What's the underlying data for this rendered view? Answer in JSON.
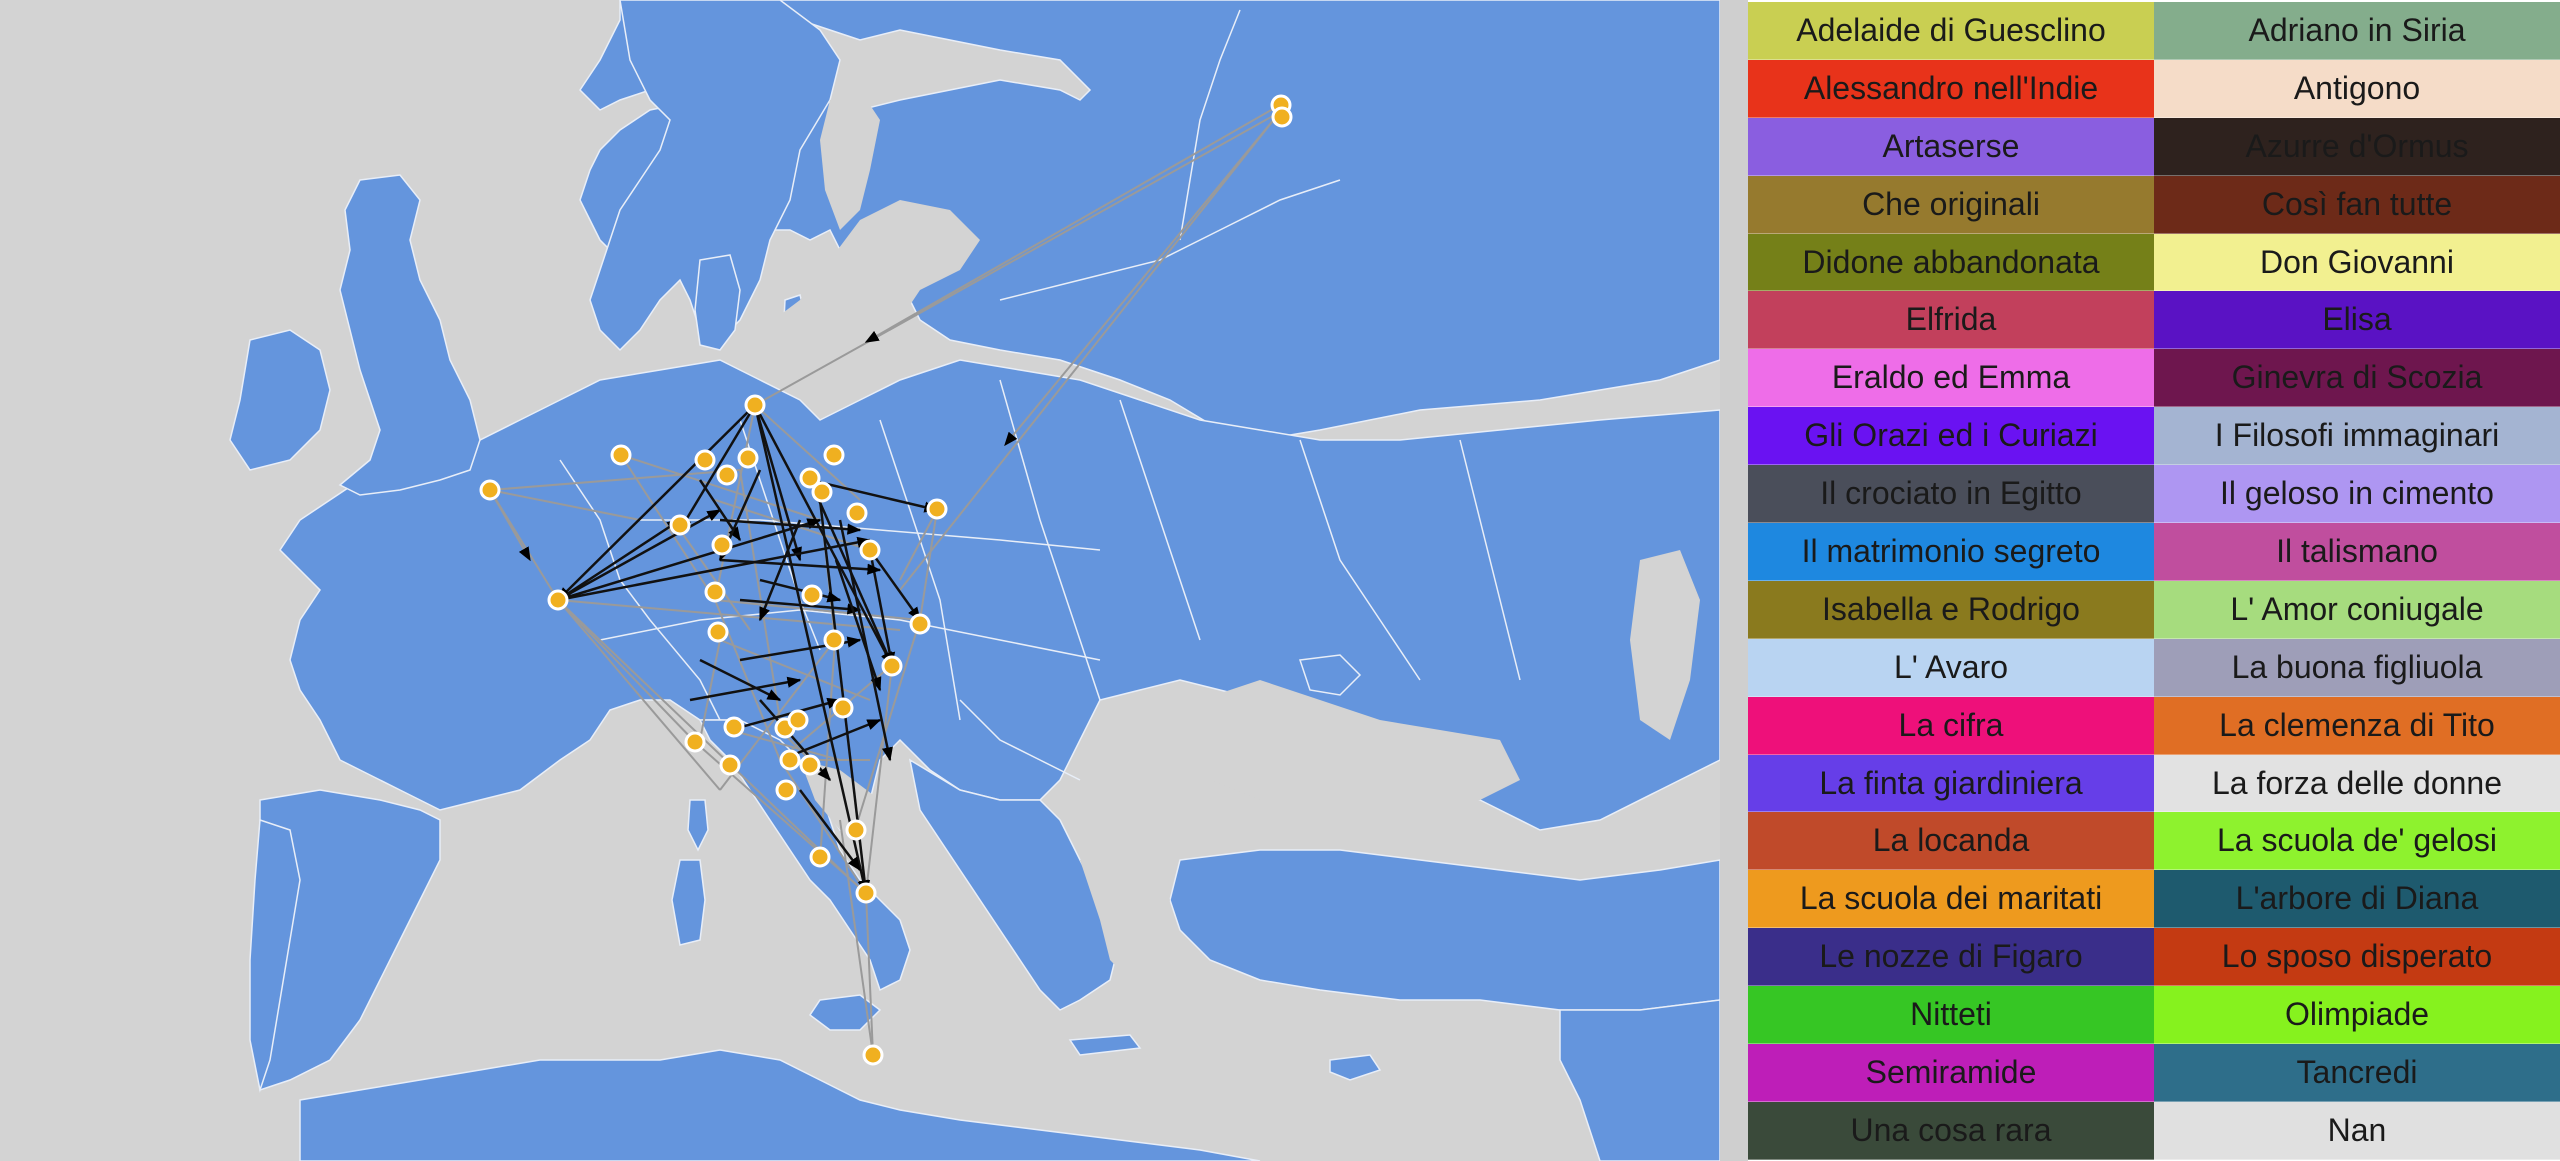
{
  "map": {
    "colors": {
      "sea": "#d3d3d3",
      "land": "#6495dd",
      "border": "#e8eef8",
      "node_fill": "#f0b020",
      "node_stroke": "#ffffff",
      "edge_light": "#9a9a9a",
      "edge_dark": "#000000"
    },
    "nodes_icon": "circle-marker",
    "edges_icon": "arrow-line"
  },
  "legend": {
    "items": [
      {
        "label": "Adelaide di Guesclino",
        "color": "#c9cf52"
      },
      {
        "label": "Adriano in Siria",
        "color": "#84ad8c"
      },
      {
        "label": "Alessandro nell'Indie",
        "color": "#e8331a"
      },
      {
        "label": "Antigono",
        "color": "#f5dcc8"
      },
      {
        "label": "Artaserse",
        "color": "#8a5ee0"
      },
      {
        "label": "Azurre d'Ormus",
        "color": "#2e221e"
      },
      {
        "label": "Che originali",
        "color": "#967a2e"
      },
      {
        "label": "Così fan tutte",
        "color": "#6d2a18"
      },
      {
        "label": "Didone abbandonata",
        "color": "#758018"
      },
      {
        "label": "Don Giovanni",
        "color": "#f2f090"
      },
      {
        "label": "Elfrida",
        "color": "#c2405c"
      },
      {
        "label": "Elisa",
        "color": "#5a12c4"
      },
      {
        "label": "Eraldo ed Emma",
        "color": "#ee6de8"
      },
      {
        "label": "Ginevra di Scozia",
        "color": "#6e164e"
      },
      {
        "label": "Gli Orazi ed i Curiazi",
        "color": "#6a12f2"
      },
      {
        "label": "I Filosofi immaginari",
        "color": "#a4b4d2"
      },
      {
        "label": "Il crociato in Egitto",
        "color": "#4a4e5a"
      },
      {
        "label": "Il geloso in cimento",
        "color": "#ae96f2"
      },
      {
        "label": "Il matrimonio segreto",
        "color": "#1e88e0"
      },
      {
        "label": "Il talismano",
        "color": "#c04e9e"
      },
      {
        "label": "Isabella e Rodrigo",
        "color": "#8a7a1e"
      },
      {
        "label": "L' Amor coniugale",
        "color": "#a6dc7e"
      },
      {
        "label": "L' Avaro",
        "color": "#b9d4f2"
      },
      {
        "label": "La buona figliuola",
        "color": "#9e9eb8"
      },
      {
        "label": "La cifra",
        "color": "#ee107a"
      },
      {
        "label": "La clemenza di Tito",
        "color": "#e06e24"
      },
      {
        "label": "La finta giardiniera",
        "color": "#663ee8"
      },
      {
        "label": "La forza delle donne",
        "color": "#e2e2e2"
      },
      {
        "label": "La locanda",
        "color": "#c04a2a"
      },
      {
        "label": "La scuola de' gelosi",
        "color": "#8ef22e"
      },
      {
        "label": "La scuola dei maritati",
        "color": "#ee9a1e"
      },
      {
        "label": "L'arbore di Diana",
        "color": "#1e5a6e"
      },
      {
        "label": "Le nozze di Figaro",
        "color": "#3a2e8a"
      },
      {
        "label": "Lo sposo disperato",
        "color": "#c43a12"
      },
      {
        "label": "Nitteti",
        "color": "#36c624"
      },
      {
        "label": "Olimpiade",
        "color": "#86f21e"
      },
      {
        "label": "Semiramide",
        "color": "#be1eb8"
      },
      {
        "label": "Tancredi",
        "color": "#2e6e8a"
      },
      {
        "label": "Una cosa rara",
        "color": "#3a4a3a"
      },
      {
        "label": "Nan",
        "color": "#e0e0e0"
      }
    ]
  }
}
